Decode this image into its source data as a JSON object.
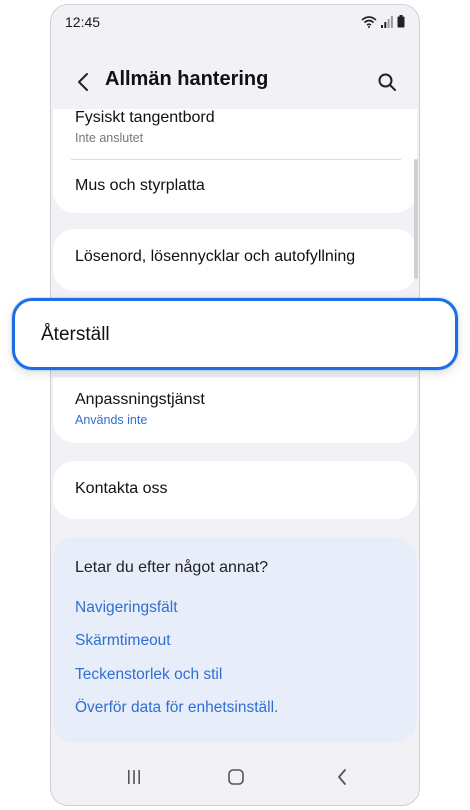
{
  "status_bar": {
    "time": "12:45",
    "icons": [
      "wifi-icon",
      "signal-icon",
      "battery-icon"
    ]
  },
  "header": {
    "title": "Allmän hantering",
    "back_icon": "chevron-left-icon",
    "search_icon": "search-icon"
  },
  "settings": {
    "items": [
      {
        "title": "Fysiskt tangentbord",
        "subtitle": "Inte anslutet"
      },
      {
        "title": "Mus och styrplatta"
      },
      {
        "title": "Lösenord, lösennycklar och autofyllning"
      },
      {
        "title": "Återställ"
      },
      {
        "title": "Anpassningstjänst",
        "subtitle": "Används inte"
      },
      {
        "title": "Kontakta oss"
      }
    ]
  },
  "suggestions": {
    "title": "Letar du efter något annat?",
    "links": [
      "Navigeringsfält",
      "Skärmtimeout",
      "Teckenstorlek och stil",
      "Överför data för enhetsinställ."
    ]
  },
  "navbar": {
    "icons": [
      "recent-apps-icon",
      "home-icon",
      "back-icon"
    ]
  },
  "colors": {
    "accent": "#1c6ee6",
    "link": "#2f6fd1",
    "background": "#f2f2f6",
    "suggest_background": "#e8eef9"
  }
}
